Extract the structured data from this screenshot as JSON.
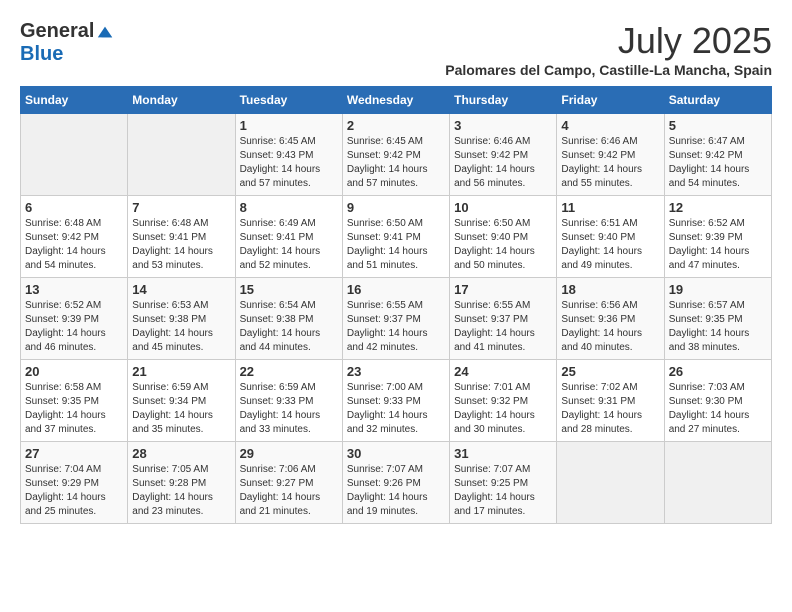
{
  "logo": {
    "general": "General",
    "blue": "Blue"
  },
  "title": {
    "month": "July 2025",
    "location": "Palomares del Campo, Castille-La Mancha, Spain"
  },
  "weekdays": [
    "Sunday",
    "Monday",
    "Tuesday",
    "Wednesday",
    "Thursday",
    "Friday",
    "Saturday"
  ],
  "weeks": [
    [
      {
        "day": "",
        "sunrise": "",
        "sunset": "",
        "daylight": ""
      },
      {
        "day": "",
        "sunrise": "",
        "sunset": "",
        "daylight": ""
      },
      {
        "day": "1",
        "sunrise": "Sunrise: 6:45 AM",
        "sunset": "Sunset: 9:43 PM",
        "daylight": "Daylight: 14 hours and 57 minutes."
      },
      {
        "day": "2",
        "sunrise": "Sunrise: 6:45 AM",
        "sunset": "Sunset: 9:42 PM",
        "daylight": "Daylight: 14 hours and 57 minutes."
      },
      {
        "day": "3",
        "sunrise": "Sunrise: 6:46 AM",
        "sunset": "Sunset: 9:42 PM",
        "daylight": "Daylight: 14 hours and 56 minutes."
      },
      {
        "day": "4",
        "sunrise": "Sunrise: 6:46 AM",
        "sunset": "Sunset: 9:42 PM",
        "daylight": "Daylight: 14 hours and 55 minutes."
      },
      {
        "day": "5",
        "sunrise": "Sunrise: 6:47 AM",
        "sunset": "Sunset: 9:42 PM",
        "daylight": "Daylight: 14 hours and 54 minutes."
      }
    ],
    [
      {
        "day": "6",
        "sunrise": "Sunrise: 6:48 AM",
        "sunset": "Sunset: 9:42 PM",
        "daylight": "Daylight: 14 hours and 54 minutes."
      },
      {
        "day": "7",
        "sunrise": "Sunrise: 6:48 AM",
        "sunset": "Sunset: 9:41 PM",
        "daylight": "Daylight: 14 hours and 53 minutes."
      },
      {
        "day": "8",
        "sunrise": "Sunrise: 6:49 AM",
        "sunset": "Sunset: 9:41 PM",
        "daylight": "Daylight: 14 hours and 52 minutes."
      },
      {
        "day": "9",
        "sunrise": "Sunrise: 6:50 AM",
        "sunset": "Sunset: 9:41 PM",
        "daylight": "Daylight: 14 hours and 51 minutes."
      },
      {
        "day": "10",
        "sunrise": "Sunrise: 6:50 AM",
        "sunset": "Sunset: 9:40 PM",
        "daylight": "Daylight: 14 hours and 50 minutes."
      },
      {
        "day": "11",
        "sunrise": "Sunrise: 6:51 AM",
        "sunset": "Sunset: 9:40 PM",
        "daylight": "Daylight: 14 hours and 49 minutes."
      },
      {
        "day": "12",
        "sunrise": "Sunrise: 6:52 AM",
        "sunset": "Sunset: 9:39 PM",
        "daylight": "Daylight: 14 hours and 47 minutes."
      }
    ],
    [
      {
        "day": "13",
        "sunrise": "Sunrise: 6:52 AM",
        "sunset": "Sunset: 9:39 PM",
        "daylight": "Daylight: 14 hours and 46 minutes."
      },
      {
        "day": "14",
        "sunrise": "Sunrise: 6:53 AM",
        "sunset": "Sunset: 9:38 PM",
        "daylight": "Daylight: 14 hours and 45 minutes."
      },
      {
        "day": "15",
        "sunrise": "Sunrise: 6:54 AM",
        "sunset": "Sunset: 9:38 PM",
        "daylight": "Daylight: 14 hours and 44 minutes."
      },
      {
        "day": "16",
        "sunrise": "Sunrise: 6:55 AM",
        "sunset": "Sunset: 9:37 PM",
        "daylight": "Daylight: 14 hours and 42 minutes."
      },
      {
        "day": "17",
        "sunrise": "Sunrise: 6:55 AM",
        "sunset": "Sunset: 9:37 PM",
        "daylight": "Daylight: 14 hours and 41 minutes."
      },
      {
        "day": "18",
        "sunrise": "Sunrise: 6:56 AM",
        "sunset": "Sunset: 9:36 PM",
        "daylight": "Daylight: 14 hours and 40 minutes."
      },
      {
        "day": "19",
        "sunrise": "Sunrise: 6:57 AM",
        "sunset": "Sunset: 9:35 PM",
        "daylight": "Daylight: 14 hours and 38 minutes."
      }
    ],
    [
      {
        "day": "20",
        "sunrise": "Sunrise: 6:58 AM",
        "sunset": "Sunset: 9:35 PM",
        "daylight": "Daylight: 14 hours and 37 minutes."
      },
      {
        "day": "21",
        "sunrise": "Sunrise: 6:59 AM",
        "sunset": "Sunset: 9:34 PM",
        "daylight": "Daylight: 14 hours and 35 minutes."
      },
      {
        "day": "22",
        "sunrise": "Sunrise: 6:59 AM",
        "sunset": "Sunset: 9:33 PM",
        "daylight": "Daylight: 14 hours and 33 minutes."
      },
      {
        "day": "23",
        "sunrise": "Sunrise: 7:00 AM",
        "sunset": "Sunset: 9:33 PM",
        "daylight": "Daylight: 14 hours and 32 minutes."
      },
      {
        "day": "24",
        "sunrise": "Sunrise: 7:01 AM",
        "sunset": "Sunset: 9:32 PM",
        "daylight": "Daylight: 14 hours and 30 minutes."
      },
      {
        "day": "25",
        "sunrise": "Sunrise: 7:02 AM",
        "sunset": "Sunset: 9:31 PM",
        "daylight": "Daylight: 14 hours and 28 minutes."
      },
      {
        "day": "26",
        "sunrise": "Sunrise: 7:03 AM",
        "sunset": "Sunset: 9:30 PM",
        "daylight": "Daylight: 14 hours and 27 minutes."
      }
    ],
    [
      {
        "day": "27",
        "sunrise": "Sunrise: 7:04 AM",
        "sunset": "Sunset: 9:29 PM",
        "daylight": "Daylight: 14 hours and 25 minutes."
      },
      {
        "day": "28",
        "sunrise": "Sunrise: 7:05 AM",
        "sunset": "Sunset: 9:28 PM",
        "daylight": "Daylight: 14 hours and 23 minutes."
      },
      {
        "day": "29",
        "sunrise": "Sunrise: 7:06 AM",
        "sunset": "Sunset: 9:27 PM",
        "daylight": "Daylight: 14 hours and 21 minutes."
      },
      {
        "day": "30",
        "sunrise": "Sunrise: 7:07 AM",
        "sunset": "Sunset: 9:26 PM",
        "daylight": "Daylight: 14 hours and 19 minutes."
      },
      {
        "day": "31",
        "sunrise": "Sunrise: 7:07 AM",
        "sunset": "Sunset: 9:25 PM",
        "daylight": "Daylight: 14 hours and 17 minutes."
      },
      {
        "day": "",
        "sunrise": "",
        "sunset": "",
        "daylight": ""
      },
      {
        "day": "",
        "sunrise": "",
        "sunset": "",
        "daylight": ""
      }
    ]
  ]
}
